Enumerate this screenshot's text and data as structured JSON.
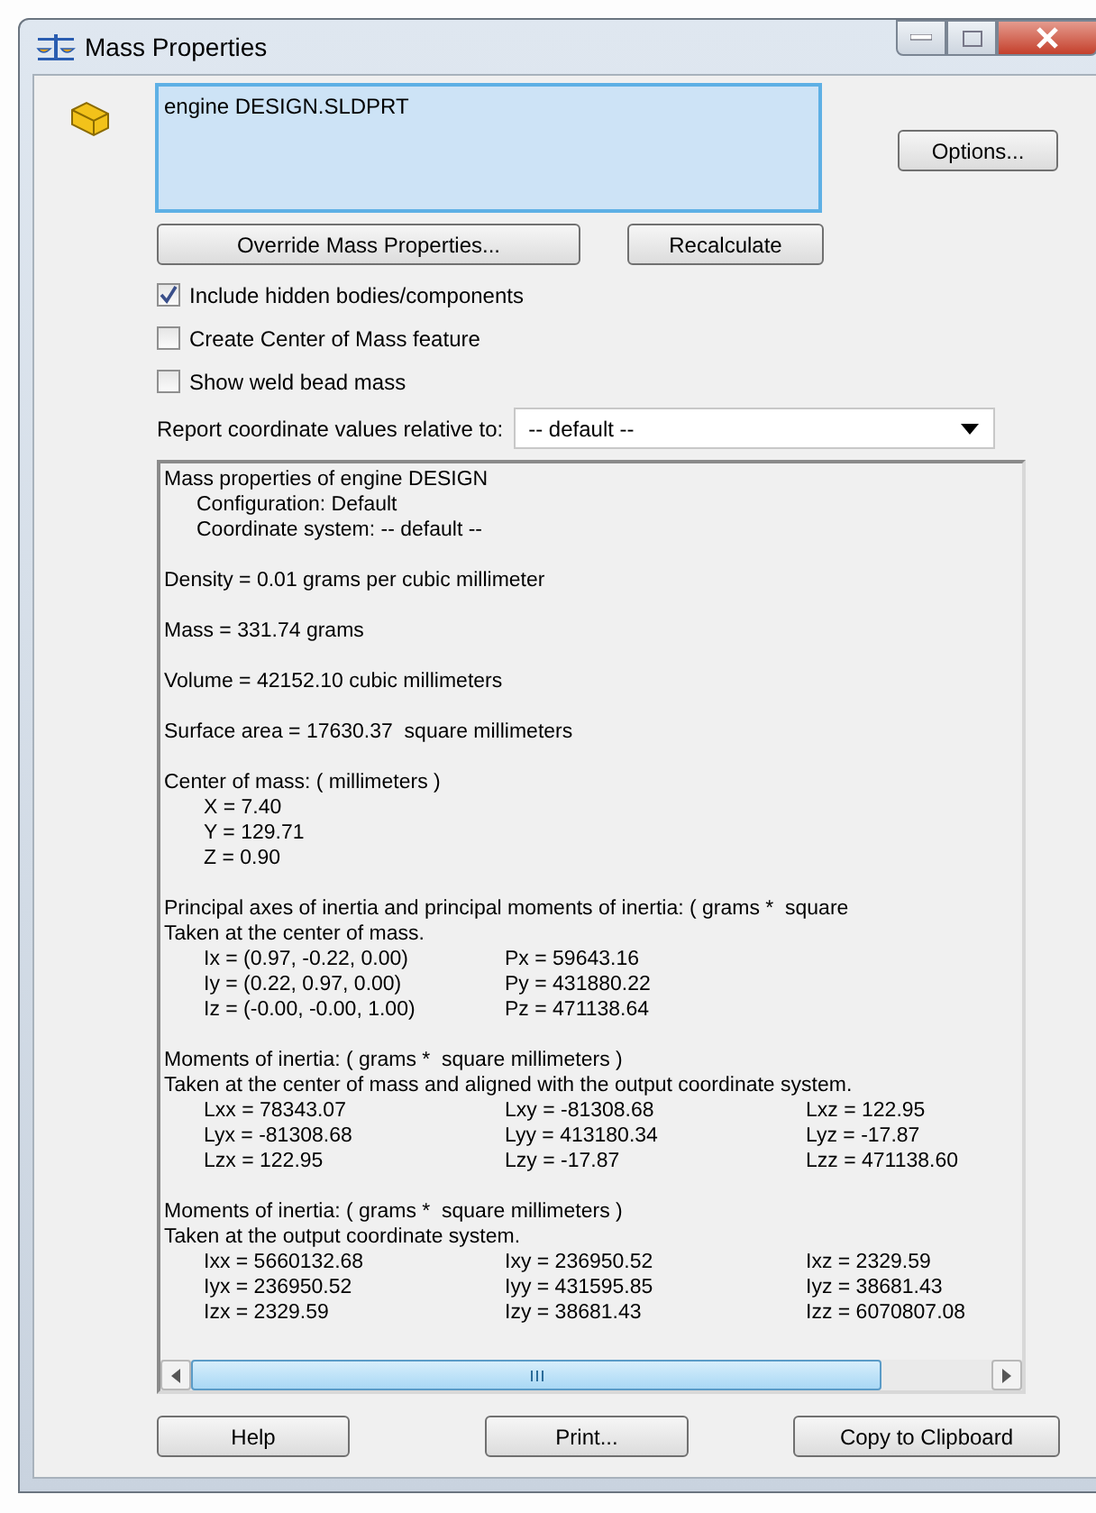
{
  "window": {
    "title": "Mass Properties"
  },
  "part_list": {
    "items": [
      "engine DESIGN.SLDPRT"
    ]
  },
  "options_button": "Options...",
  "action_buttons": [
    "Override Mass Properties...",
    "Recalculate"
  ],
  "checkboxes": [
    {
      "label": "Include hidden bodies/components",
      "checked": true
    },
    {
      "label": "Create Center of Mass feature",
      "checked": false
    },
    {
      "label": "Show weld bead mass",
      "checked": false
    }
  ],
  "coordinate": {
    "label": "Report coordinate values relative to:",
    "value": "-- default --"
  },
  "report": {
    "sections": [
      {
        "lines": [
          {
            "kind": "text",
            "text": "Mass properties of engine DESIGN"
          },
          {
            "kind": "indent",
            "text": "Configuration: Default"
          },
          {
            "kind": "indent",
            "text": "Coordinate system: -- default --"
          }
        ]
      },
      {
        "lines": [
          {
            "kind": "text",
            "text": "Density = 0.01 grams per cubic millimeter"
          }
        ]
      },
      {
        "lines": [
          {
            "kind": "text",
            "text": "Mass = 331.74 grams"
          }
        ]
      },
      {
        "lines": [
          {
            "kind": "text",
            "text": "Volume = 42152.10 cubic millimeters"
          }
        ]
      },
      {
        "lines": [
          {
            "kind": "text",
            "text": "Surface area = 17630.37  square millimeters"
          }
        ]
      },
      {
        "lines": [
          {
            "kind": "text",
            "text": "Center of mass: ( millimeters )"
          },
          {
            "kind": "values",
            "cells": [
              "X = 7.40"
            ]
          },
          {
            "kind": "values",
            "cells": [
              "Y = 129.71"
            ]
          },
          {
            "kind": "values",
            "cells": [
              "Z = 0.90"
            ]
          }
        ]
      },
      {
        "lines": [
          {
            "kind": "text",
            "text": "Principal axes of inertia and principal moments of inertia: ( grams *  square"
          },
          {
            "kind": "text",
            "text": "Taken at the center of mass."
          },
          {
            "kind": "values",
            "cells": [
              "Ix = (0.97, -0.22, 0.00)",
              "Px = 59643.16"
            ]
          },
          {
            "kind": "values",
            "cells": [
              "Iy = (0.22, 0.97, 0.00)",
              "Py = 431880.22"
            ]
          },
          {
            "kind": "values",
            "cells": [
              "Iz = (-0.00, -0.00, 1.00)",
              "Pz = 471138.64"
            ]
          }
        ]
      },
      {
        "lines": [
          {
            "kind": "text",
            "text": "Moments of inertia: ( grams *  square millimeters )"
          },
          {
            "kind": "text",
            "text": "Taken at the center of mass and aligned with the output coordinate system."
          },
          {
            "kind": "values",
            "cells": [
              "Lxx = 78343.07",
              "Lxy = -81308.68",
              "Lxz = 122.95"
            ]
          },
          {
            "kind": "values",
            "cells": [
              "Lyx = -81308.68",
              "Lyy = 413180.34",
              "Lyz = -17.87"
            ]
          },
          {
            "kind": "values",
            "cells": [
              "Lzx = 122.95",
              "Lzy = -17.87",
              "Lzz = 471138.60"
            ]
          }
        ]
      },
      {
        "lines": [
          {
            "kind": "text",
            "text": "Moments of inertia: ( grams *  square millimeters )"
          },
          {
            "kind": "text",
            "text": "Taken at the output coordinate system."
          },
          {
            "kind": "values",
            "cells": [
              "Ixx = 5660132.68",
              "Ixy = 236950.52",
              "Ixz = 2329.59"
            ]
          },
          {
            "kind": "values",
            "cells": [
              "Iyx = 236950.52",
              "Iyy = 431595.85",
              "Iyz = 38681.43"
            ]
          },
          {
            "kind": "values",
            "cells": [
              "Izx = 2329.59",
              "Izy = 38681.43",
              "Izz = 6070807.08"
            ]
          }
        ]
      }
    ]
  },
  "bottom_buttons": [
    "Help",
    "Print...",
    "Copy to Clipboard"
  ]
}
